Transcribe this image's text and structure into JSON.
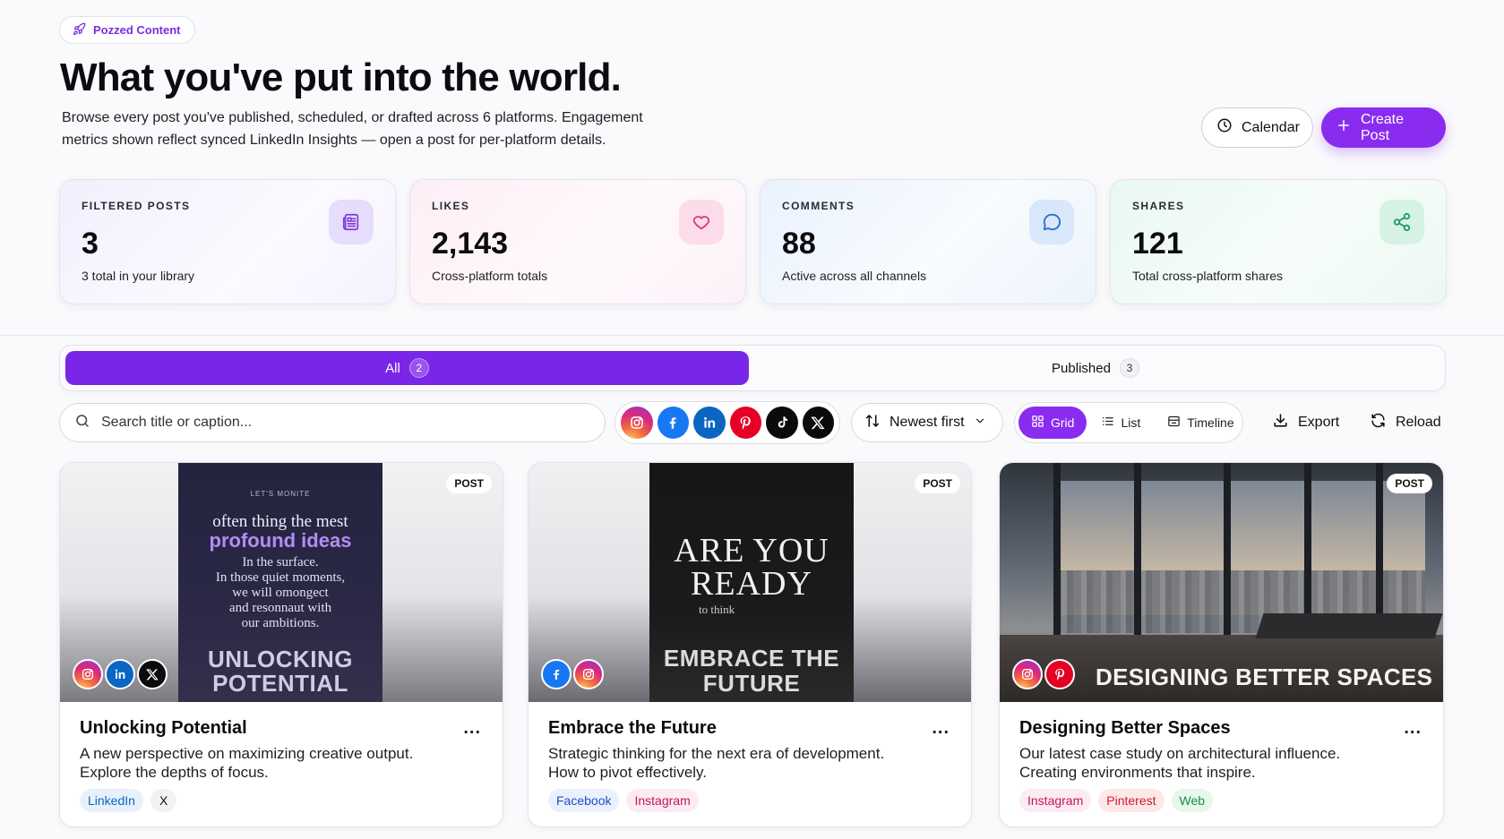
{
  "header": {
    "pill_label": "Pozzed Content",
    "title": "What you've put into the world.",
    "subtitle": "Browse every post you've published, scheduled, or drafted across 6 platforms. Engagement metrics shown reflect synced LinkedIn Insights — open a post for per-platform details.",
    "calendar_label": "Calendar",
    "create_label": "Create Post"
  },
  "stats": [
    {
      "label": "FILTERED POSTS",
      "value": "3",
      "sub": "3 total in your library",
      "icon": "newspaper-icon"
    },
    {
      "label": "LIKES",
      "value": "2,143",
      "sub": "Cross-platform totals",
      "icon": "heart-icon"
    },
    {
      "label": "COMMENTS",
      "value": "88",
      "sub": "Active across all channels",
      "icon": "comment-icon"
    },
    {
      "label": "SHARES",
      "value": "121",
      "sub": "Total cross-platform shares",
      "icon": "share-icon"
    }
  ],
  "tabs": [
    {
      "label": "All",
      "count": "2",
      "active": true
    },
    {
      "label": "Published",
      "count": "3",
      "active": false
    }
  ],
  "toolbar": {
    "search_placeholder": "Search title or caption...",
    "platforms": [
      "instagram",
      "facebook",
      "linkedin",
      "pinterest",
      "tiktok",
      "x"
    ],
    "sort_label": "Newest first",
    "views": [
      {
        "label": "Grid",
        "active": true
      },
      {
        "label": "List",
        "active": false
      },
      {
        "label": "Timeline",
        "active": false
      }
    ],
    "export_label": "Export",
    "reload_label": "Reload"
  },
  "cards": [
    {
      "badge": "POST",
      "title": "Unlocking Potential",
      "desc_line1": "A new perspective on maximizing creative output.",
      "desc_line2": "Explore the depths of focus.",
      "chips": [
        "LinkedIn",
        "X"
      ],
      "more": "...",
      "poster": {
        "tag": "LET'S MONITE",
        "line1": "often thing the mest",
        "highlight": "profound ideas",
        "body1": "In the surface.",
        "body2": "In those quiet moments,",
        "body3": "we will omongect",
        "body4": "and resonnaut with",
        "body5": "our ambitions.",
        "big1": "UNLOCKING",
        "big2": "POTENTIAL"
      }
    },
    {
      "badge": "POST",
      "title": "Embrace the Future",
      "desc_line1": "Strategic thinking for the next era of development.",
      "desc_line2": "How to pivot effectively.",
      "chips": [
        "Facebook",
        "Instagram"
      ],
      "more": "...",
      "poster": {
        "big1": "ARE YOU",
        "big2": "READY",
        "small": "to think",
        "bottom1": "EMBRACE THE",
        "bottom2": "FUTURE"
      }
    },
    {
      "badge": "POST",
      "title": "Designing Better Spaces",
      "desc_line1": "Our latest case study on architectural influence.",
      "desc_line2": "Creating environments that inspire.",
      "chips": [
        "Instagram",
        "Pinterest",
        "Web"
      ],
      "more": "...",
      "scene_title": "DESIGNING BETTER SPACES"
    }
  ],
  "colors": {
    "accent": "#8a2cf0",
    "tab_active": "#7a26e8"
  }
}
